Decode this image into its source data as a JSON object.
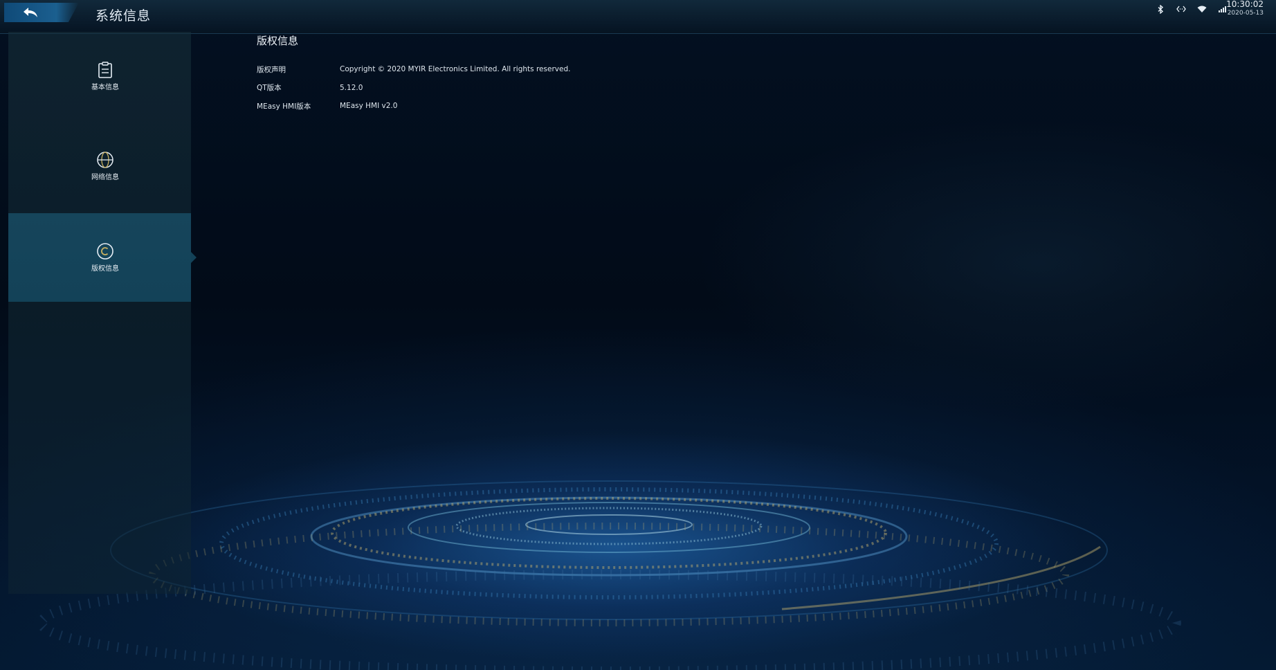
{
  "header": {
    "title": "系统信息",
    "back_icon": "back-arrow-icon",
    "status_icons": [
      "bluetooth-icon",
      "ethernet-icon",
      "wifi-icon",
      "signal-icon"
    ],
    "time": "10:30:02",
    "date": "2020-05-13"
  },
  "sidebar": {
    "items": [
      {
        "label": "基本信息",
        "icon": "clipboard-icon",
        "active": false
      },
      {
        "label": "网络信息",
        "icon": "globe-icon",
        "active": false
      },
      {
        "label": "版权信息",
        "icon": "copyright-icon",
        "active": true
      }
    ]
  },
  "content": {
    "section_title": "版权信息",
    "rows": [
      {
        "key": "版权声明",
        "value": "Copyright © 2020 MYIR Electronics Limited. All rights reserved."
      },
      {
        "key": "QT版本",
        "value": "5.12.0"
      },
      {
        "key": "MEasy HMI版本",
        "value": "MEasy HMI v2.0"
      }
    ]
  },
  "colors": {
    "background": "#020a16",
    "sidebar_active": "#16455b",
    "back_button": "#1b5f8f",
    "accent_ring": "#c8b060"
  }
}
